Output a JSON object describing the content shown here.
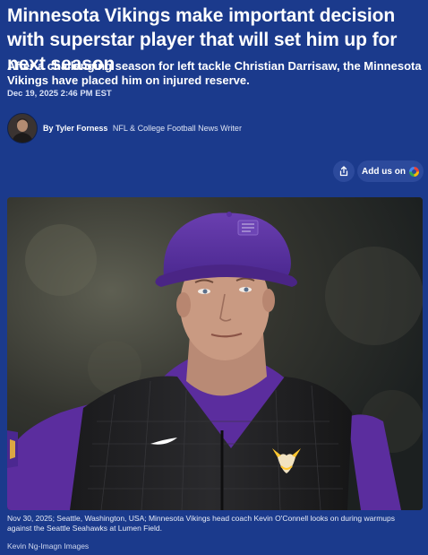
{
  "article": {
    "headline": "Minnesota Vikings make important decision with superstar player that will set him up for next season",
    "subhead": "After a challenging season for left tackle Christian Darrisaw, the Minnesota Vikings have placed him on injured reserve.",
    "date": "Dec 19, 2025 2:46 PM EST"
  },
  "author": {
    "by_label": "By Tyler Forness",
    "role": "NFL & College Football News Writer",
    "avatar_icon": "author-avatar"
  },
  "actions": {
    "share_icon": "share-icon",
    "add_label": "Add us on",
    "add_icon": "google-icon"
  },
  "photo": {
    "caption": "Nov 30, 2025; Seattle, Washington, USA; Minnesota Vikings head coach Kevin O'Connell looks on during warmups against the Seattle Seahawks at Lumen Field.",
    "credit": "Kevin Ng-Imagn Images"
  },
  "colors": {
    "background": "#1b3a8c",
    "button": "#2c4a9c",
    "vikings_purple": "#4f2683",
    "vikings_gold": "#ffc62f"
  }
}
